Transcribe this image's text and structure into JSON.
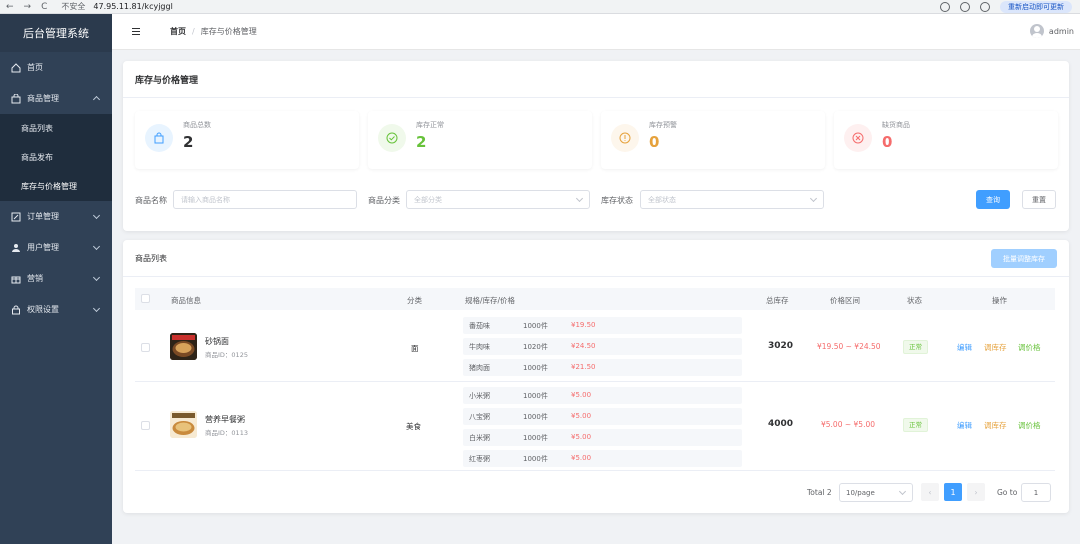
{
  "browser": {
    "nav": [
      "←",
      "→",
      "C"
    ],
    "security_label": "不安全",
    "url": "47.95.11.81/kcyjggl",
    "update_label": "重新启动即可更新"
  },
  "sidebar": {
    "brand": "后台管理系统",
    "home": "首页",
    "product_mgmt": "商品管理",
    "sub_items": [
      "商品列表",
      "商品发布",
      "库存与价格管理"
    ],
    "orders": "订单管理",
    "users": "用户管理",
    "marketing": "营销",
    "permissions": "权限设置"
  },
  "header": {
    "breadcrumb_home": "首页",
    "breadcrumb_sep": "/",
    "breadcrumb_current": "库存与价格管理",
    "username": "admin"
  },
  "page": {
    "title": "库存与价格管理",
    "stats": [
      {
        "label": "商品总数",
        "value": "2",
        "color": "#303133",
        "icon": "bag-icon"
      },
      {
        "label": "库存正常",
        "value": "2",
        "color": "#67c23a",
        "icon": "check-circle-icon"
      },
      {
        "label": "库存预警",
        "value": "0",
        "color": "#e6a23c",
        "icon": "warning-circle-icon"
      },
      {
        "label": "缺货商品",
        "value": "0",
        "color": "#f56c6c",
        "icon": "close-circle-icon"
      }
    ],
    "filters": {
      "name_label": "商品名称",
      "name_placeholder": "请输入商品名称",
      "category_label": "商品分类",
      "category_value": "全部分类",
      "status_label": "库存状态",
      "status_value": "全部状态",
      "search_btn": "查询",
      "reset_btn": "重置"
    }
  },
  "list": {
    "title": "商品列表",
    "batch_btn": "批量调整库存",
    "columns": [
      "商品信息",
      "分类",
      "规格/库存/价格",
      "总库存",
      "价格区间",
      "状态",
      "操作"
    ],
    "rows": [
      {
        "name": "砂锅面",
        "id": "商品ID：0125",
        "category": "面",
        "specs": [
          {
            "name": "番茄味",
            "stock": "1000件",
            "price": "¥19.50"
          },
          {
            "name": "牛肉味",
            "stock": "1020件",
            "price": "¥24.50"
          },
          {
            "name": "猪肉面",
            "stock": "1000件",
            "price": "¥21.50"
          }
        ],
        "total": "3020",
        "range": "¥19.50 ~ ¥24.50",
        "status": "正常",
        "ops": [
          "编辑",
          "调库存",
          "调价格"
        ]
      },
      {
        "name": "营养早餐粥",
        "id": "商品ID：0113",
        "category": "美食",
        "specs": [
          {
            "name": "小米粥",
            "stock": "1000件",
            "price": "¥5.00"
          },
          {
            "name": "八宝粥",
            "stock": "1000件",
            "price": "¥5.00"
          },
          {
            "name": "白米粥",
            "stock": "1000件",
            "price": "¥5.00"
          },
          {
            "name": "红枣粥",
            "stock": "1000件",
            "price": "¥5.00"
          }
        ],
        "total": "4000",
        "range": "¥5.00 ~ ¥5.00",
        "status": "正常",
        "ops": [
          "编辑",
          "调库存",
          "调价格"
        ]
      }
    ],
    "op_colors": {
      "edit": "#409eff",
      "stock": "#e6a23c",
      "price": "#67c23a"
    },
    "pagination": {
      "total": "Total 2",
      "page_size": "10/page",
      "prev": "‹",
      "current": "1",
      "next": "›",
      "goto_label": "Go to",
      "goto_value": "1"
    }
  }
}
